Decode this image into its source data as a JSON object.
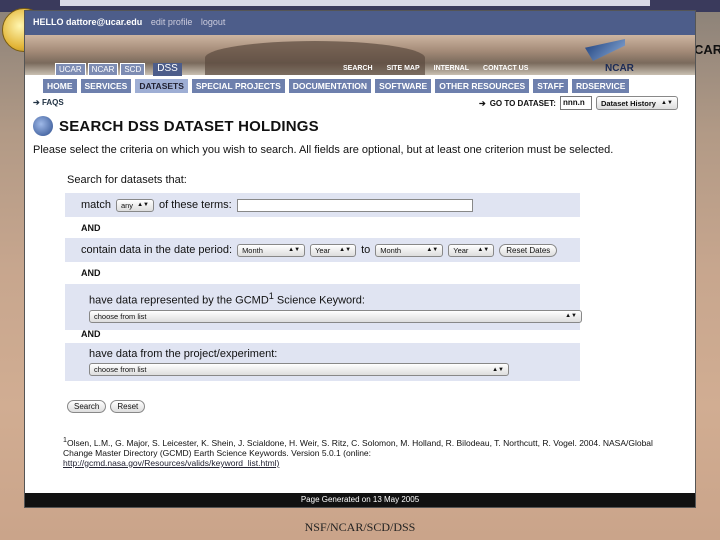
{
  "slide": {
    "caption": "NSF/NCAR/SCD/DSS",
    "ncar_edge": "CAR"
  },
  "topbar": {
    "greeting": "HELLO dattore@ucar.edu",
    "edit_profile": "edit profile",
    "logout": "logout"
  },
  "banner": {
    "small_tabs": [
      "UCAR",
      "NCAR",
      "SCD"
    ],
    "dss_tab": "DSS",
    "top_links": [
      "SEARCH",
      "SITE MAP",
      "INTERNAL",
      "CONTACT US"
    ],
    "logo_text": "NCAR"
  },
  "nav": [
    "HOME",
    "SERVICES",
    "DATASETS",
    "SPECIAL PROJECTS",
    "DOCUMENTATION",
    "SOFTWARE",
    "OTHER RESOURCES",
    "STAFF",
    "RDSERVICE"
  ],
  "faqs": "FAQS",
  "goto": {
    "label": "GO TO DATASET:",
    "value": "nnn.n",
    "history": "Dataset History"
  },
  "page": {
    "title": "SEARCH DSS DATASET HOLDINGS",
    "intro": "Please select the criteria on which you wish to search. All fields are optional, but at least one criterion must be selected.",
    "search_label": "Search for datasets that:"
  },
  "criteria": {
    "match_label": "match",
    "match_value": "any",
    "terms_label": "of these terms:",
    "and": "AND",
    "date_label": "contain data in the date period:",
    "month": "Month",
    "year": "Year",
    "to": "to",
    "reset_dates": "Reset Dates",
    "gcmd_label_pre": "have data represented by the GCMD",
    "gcmd_sup": "1",
    "gcmd_label_post": "Science Keyword:",
    "choose": "choose from list",
    "project_label": "have data from the project/experiment:"
  },
  "buttons": {
    "search": "Search",
    "reset": "Reset"
  },
  "footnote": {
    "marker": "1",
    "text": "Olsen, L.M., G. Major, S. Leicester, K. Shein, J. Scialdone, H. Weir, S. Ritz, C. Solomon, M. Holland, R. Bilodeau, T. Northcutt, R. Vogel. 2004. NASA/Global Change Master Directory (GCMD) Earth Science Keywords. Version 5.0.1 (online:",
    "link": "http://gcmd.nasa.gov/Resources/valids/keyword_list.html)"
  },
  "footer": "Page Generated on 13 May 2005"
}
